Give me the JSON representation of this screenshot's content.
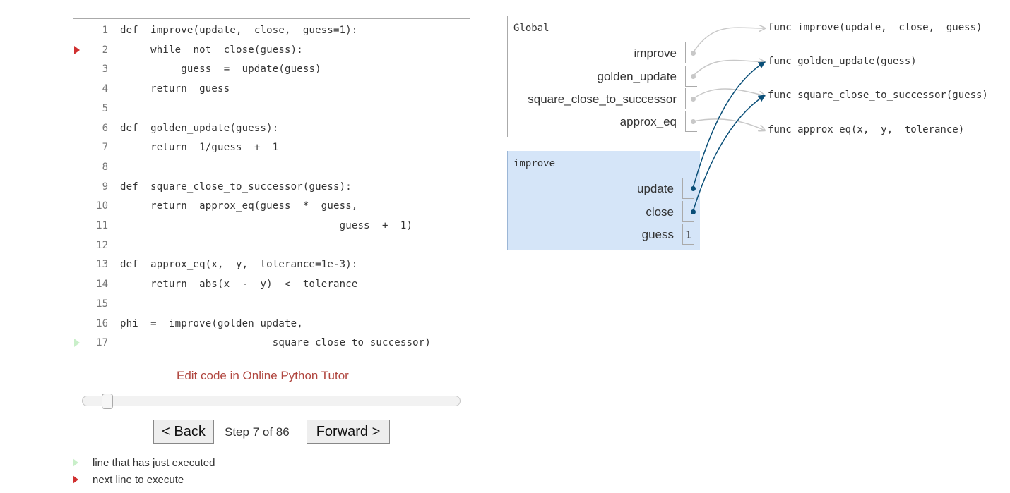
{
  "code": {
    "lines": [
      {
        "num": "1",
        "text": "def  improve(update,  close,  guess=1):",
        "marker": ""
      },
      {
        "num": "2",
        "text": "     while  not  close(guess):",
        "marker": "next"
      },
      {
        "num": "3",
        "text": "          guess  =  update(guess)",
        "marker": ""
      },
      {
        "num": "4",
        "text": "     return  guess",
        "marker": ""
      },
      {
        "num": "5",
        "text": "",
        "marker": ""
      },
      {
        "num": "6",
        "text": "def  golden_update(guess):",
        "marker": ""
      },
      {
        "num": "7",
        "text": "     return  1/guess  +  1",
        "marker": ""
      },
      {
        "num": "8",
        "text": "",
        "marker": ""
      },
      {
        "num": "9",
        "text": "def  square_close_to_successor(guess):",
        "marker": ""
      },
      {
        "num": "10",
        "text": "     return  approx_eq(guess  *  guess,",
        "marker": ""
      },
      {
        "num": "11",
        "text": "                                    guess  +  1)",
        "marker": ""
      },
      {
        "num": "12",
        "text": "",
        "marker": ""
      },
      {
        "num": "13",
        "text": "def  approx_eq(x,  y,  tolerance=1e-3):",
        "marker": ""
      },
      {
        "num": "14",
        "text": "     return  abs(x  -  y)  <  tolerance",
        "marker": ""
      },
      {
        "num": "15",
        "text": "",
        "marker": ""
      },
      {
        "num": "16",
        "text": "phi  =  improve(golden_update,",
        "marker": ""
      },
      {
        "num": "17",
        "text": "                         square_close_to_successor)",
        "marker": "prev"
      }
    ]
  },
  "controls": {
    "edit_link": "Edit code in Online Python Tutor",
    "back_label": "< Back",
    "forward_label": "Forward >",
    "step_text": "Step 7 of 86",
    "current_step": 7,
    "total_steps": 86
  },
  "legend": {
    "prev_text": "line that has just executed",
    "next_text": "next line to execute"
  },
  "frames": {
    "global": {
      "title": "Global",
      "vars": [
        "improve",
        "golden_update",
        "square_close_to_successor",
        "approx_eq"
      ]
    },
    "improve": {
      "title": "improve",
      "vars": [
        {
          "name": "update",
          "value": ""
        },
        {
          "name": "close",
          "value": ""
        },
        {
          "name": "guess",
          "value": "1"
        }
      ]
    }
  },
  "objects": [
    "func improve(update,  close,  guess)",
    "func golden_update(guess)",
    "func square_close_to_successor(guess)",
    "func approx_eq(x,  y,  tolerance)"
  ],
  "colors": {
    "next_arrow": "#d03030",
    "prev_arrow": "#c9efc9",
    "frame_bg": "#d5e5f8",
    "pointer_blue": "#0a4f78",
    "pointer_gray": "#c8c8c8",
    "link": "#b0463f"
  }
}
